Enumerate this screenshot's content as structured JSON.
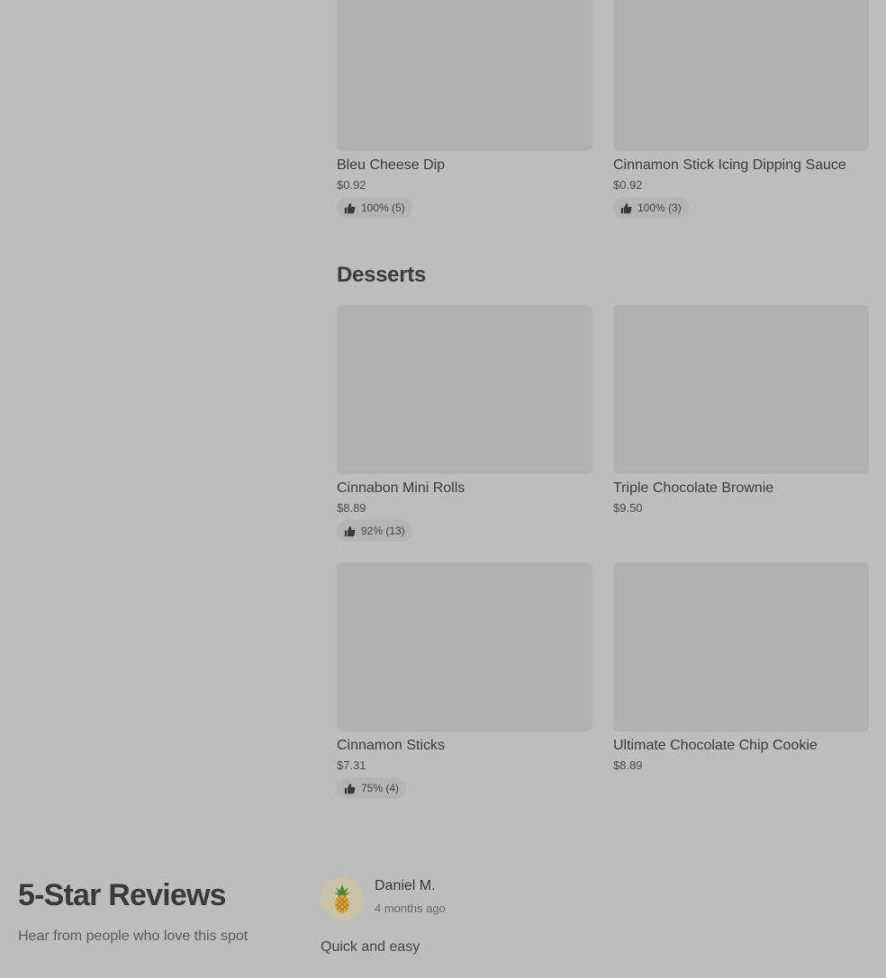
{
  "sides": {
    "items": [
      {
        "name": "Bleu Cheese Dip",
        "price": "$0.92",
        "rating": "100% (5)"
      },
      {
        "name": "Cinnamon Stick Icing Dipping Sauce",
        "price": "$0.92",
        "rating": "100% (3)"
      }
    ]
  },
  "desserts": {
    "title": "Desserts",
    "items": [
      {
        "name": "Cinnabon Mini Rolls",
        "price": "$8.89",
        "rating": "92% (13)"
      },
      {
        "name": "Triple Chocolate Brownie",
        "price": "$9.50"
      },
      {
        "name": "Cinnamon Sticks",
        "price": "$7.31",
        "rating": "75% (4)"
      },
      {
        "name": "Ultimate Chocolate Chip Cookie",
        "price": "$8.89"
      }
    ]
  },
  "reviews": {
    "title": "5-Star Reviews",
    "subtitle": "Hear from people who love this spot",
    "items": [
      {
        "reviewer": "Daniel M.",
        "time": "4 months ago",
        "text": "Quick and easy",
        "avatar_icon": "pineapple-icon"
      }
    ]
  },
  "icons": {
    "rating": "thumbs-up-icon"
  },
  "colors": {
    "background": "#bdbdbd",
    "image_placeholder": "#b1b1b1",
    "pill": "#b4b4b4"
  }
}
